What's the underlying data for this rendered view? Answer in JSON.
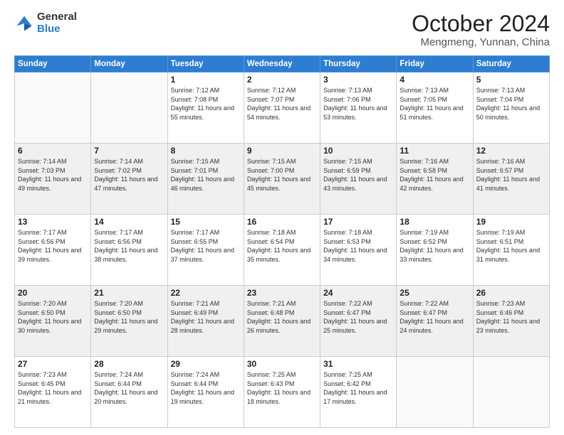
{
  "logo": {
    "line1": "General",
    "line2": "Blue"
  },
  "title": "October 2024",
  "location": "Mengmeng, Yunnan, China",
  "weekdays": [
    "Sunday",
    "Monday",
    "Tuesday",
    "Wednesday",
    "Thursday",
    "Friday",
    "Saturday"
  ],
  "weeks": [
    [
      {
        "day": "",
        "info": ""
      },
      {
        "day": "",
        "info": ""
      },
      {
        "day": "1",
        "info": "Sunrise: 7:12 AM\nSunset: 7:08 PM\nDaylight: 11 hours and 55 minutes."
      },
      {
        "day": "2",
        "info": "Sunrise: 7:12 AM\nSunset: 7:07 PM\nDaylight: 11 hours and 54 minutes."
      },
      {
        "day": "3",
        "info": "Sunrise: 7:13 AM\nSunset: 7:06 PM\nDaylight: 11 hours and 53 minutes."
      },
      {
        "day": "4",
        "info": "Sunrise: 7:13 AM\nSunset: 7:05 PM\nDaylight: 11 hours and 51 minutes."
      },
      {
        "day": "5",
        "info": "Sunrise: 7:13 AM\nSunset: 7:04 PM\nDaylight: 11 hours and 50 minutes."
      }
    ],
    [
      {
        "day": "6",
        "info": "Sunrise: 7:14 AM\nSunset: 7:03 PM\nDaylight: 11 hours and 49 minutes."
      },
      {
        "day": "7",
        "info": "Sunrise: 7:14 AM\nSunset: 7:02 PM\nDaylight: 11 hours and 47 minutes."
      },
      {
        "day": "8",
        "info": "Sunrise: 7:15 AM\nSunset: 7:01 PM\nDaylight: 11 hours and 46 minutes."
      },
      {
        "day": "9",
        "info": "Sunrise: 7:15 AM\nSunset: 7:00 PM\nDaylight: 11 hours and 45 minutes."
      },
      {
        "day": "10",
        "info": "Sunrise: 7:15 AM\nSunset: 6:59 PM\nDaylight: 11 hours and 43 minutes."
      },
      {
        "day": "11",
        "info": "Sunrise: 7:16 AM\nSunset: 6:58 PM\nDaylight: 11 hours and 42 minutes."
      },
      {
        "day": "12",
        "info": "Sunrise: 7:16 AM\nSunset: 6:57 PM\nDaylight: 11 hours and 41 minutes."
      }
    ],
    [
      {
        "day": "13",
        "info": "Sunrise: 7:17 AM\nSunset: 6:56 PM\nDaylight: 11 hours and 39 minutes."
      },
      {
        "day": "14",
        "info": "Sunrise: 7:17 AM\nSunset: 6:56 PM\nDaylight: 11 hours and 38 minutes."
      },
      {
        "day": "15",
        "info": "Sunrise: 7:17 AM\nSunset: 6:55 PM\nDaylight: 11 hours and 37 minutes."
      },
      {
        "day": "16",
        "info": "Sunrise: 7:18 AM\nSunset: 6:54 PM\nDaylight: 11 hours and 35 minutes."
      },
      {
        "day": "17",
        "info": "Sunrise: 7:18 AM\nSunset: 6:53 PM\nDaylight: 11 hours and 34 minutes."
      },
      {
        "day": "18",
        "info": "Sunrise: 7:19 AM\nSunset: 6:52 PM\nDaylight: 11 hours and 33 minutes."
      },
      {
        "day": "19",
        "info": "Sunrise: 7:19 AM\nSunset: 6:51 PM\nDaylight: 11 hours and 31 minutes."
      }
    ],
    [
      {
        "day": "20",
        "info": "Sunrise: 7:20 AM\nSunset: 6:50 PM\nDaylight: 11 hours and 30 minutes."
      },
      {
        "day": "21",
        "info": "Sunrise: 7:20 AM\nSunset: 6:50 PM\nDaylight: 11 hours and 29 minutes."
      },
      {
        "day": "22",
        "info": "Sunrise: 7:21 AM\nSunset: 6:49 PM\nDaylight: 11 hours and 28 minutes."
      },
      {
        "day": "23",
        "info": "Sunrise: 7:21 AM\nSunset: 6:48 PM\nDaylight: 11 hours and 26 minutes."
      },
      {
        "day": "24",
        "info": "Sunrise: 7:22 AM\nSunset: 6:47 PM\nDaylight: 11 hours and 25 minutes."
      },
      {
        "day": "25",
        "info": "Sunrise: 7:22 AM\nSunset: 6:47 PM\nDaylight: 11 hours and 24 minutes."
      },
      {
        "day": "26",
        "info": "Sunrise: 7:23 AM\nSunset: 6:46 PM\nDaylight: 11 hours and 23 minutes."
      }
    ],
    [
      {
        "day": "27",
        "info": "Sunrise: 7:23 AM\nSunset: 6:45 PM\nDaylight: 11 hours and 21 minutes."
      },
      {
        "day": "28",
        "info": "Sunrise: 7:24 AM\nSunset: 6:44 PM\nDaylight: 11 hours and 20 minutes."
      },
      {
        "day": "29",
        "info": "Sunrise: 7:24 AM\nSunset: 6:44 PM\nDaylight: 11 hours and 19 minutes."
      },
      {
        "day": "30",
        "info": "Sunrise: 7:25 AM\nSunset: 6:43 PM\nDaylight: 11 hours and 18 minutes."
      },
      {
        "day": "31",
        "info": "Sunrise: 7:25 AM\nSunset: 6:42 PM\nDaylight: 11 hours and 17 minutes."
      },
      {
        "day": "",
        "info": ""
      },
      {
        "day": "",
        "info": ""
      }
    ]
  ]
}
